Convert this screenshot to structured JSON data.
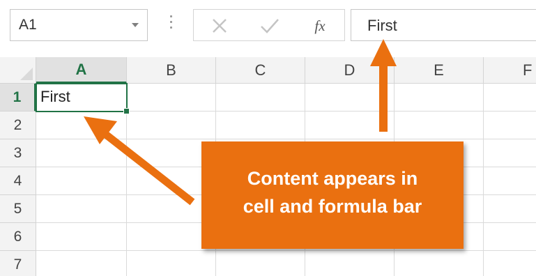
{
  "name_box": {
    "value": "A1",
    "dropdown_icon": "chevron-down-icon"
  },
  "formula_bar": {
    "cancel_icon": "close-icon",
    "enter_icon": "checkmark-icon",
    "insert_function_label": "fx",
    "content": "First"
  },
  "grid": {
    "columns": [
      "A",
      "B",
      "C",
      "D",
      "E",
      "F"
    ],
    "rows": [
      "1",
      "2",
      "3",
      "4",
      "5",
      "6",
      "7"
    ],
    "active_column": "A",
    "active_row": "1",
    "cells": {
      "A1": "First"
    }
  },
  "callout": {
    "line1": "Content appears in",
    "line2": "cell and formula bar"
  },
  "colors": {
    "accent": "#217346",
    "callout": "#ea7010"
  }
}
